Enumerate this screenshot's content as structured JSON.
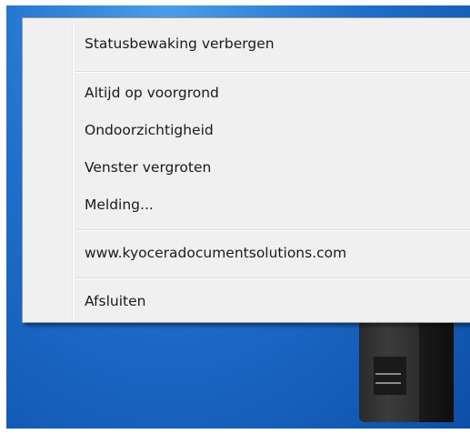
{
  "menu": {
    "items": [
      {
        "label": "Statusbewaking verbergen"
      },
      {
        "label": "Altijd op voorgrond"
      },
      {
        "label": "Ondoorzichtigheid"
      },
      {
        "label": "Venster vergroten"
      },
      {
        "label": "Melding..."
      },
      {
        "label": "www.kyoceradocumentsolutions.com"
      },
      {
        "label": "Afsluiten"
      }
    ]
  },
  "colors": {
    "desktop_blue": "#1f6fcc",
    "menu_background": "#f0f0f0",
    "menu_text": "#1a1a1a"
  },
  "icons": {
    "printer": "printer-icon"
  }
}
